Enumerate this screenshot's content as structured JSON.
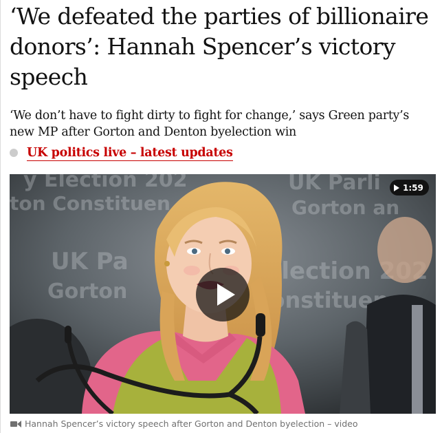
{
  "article": {
    "headline": "‘We defeated the parties of billionaire donors’: Hannah Spencer’s victory speech",
    "standfirst": "‘We don’t have to fight dirty to fight for change,’ says Green party’s new MP after Gorton and Denton byelection win",
    "live_link_label": "UK politics live – latest updates"
  },
  "video": {
    "duration": "1:59",
    "caption": "Hannah Spencer’s victory speech after Gorton and Denton byelection – video",
    "backdrop_text": [
      "y Election 202",
      "ton Constituen",
      "UK Parli",
      "Gorton an",
      "UK Pa",
      "Gorton",
      "yElection 202",
      "Constituen"
    ]
  },
  "icons": {
    "live_indicator": "grey-dot-icon",
    "duration_play": "play-triangle-icon",
    "play": "play-icon",
    "caption": "video-camera-icon"
  },
  "colors": {
    "headline": "#121212",
    "live_link": "#c70000",
    "caption": "#707070",
    "play_overlay": "#121212"
  }
}
